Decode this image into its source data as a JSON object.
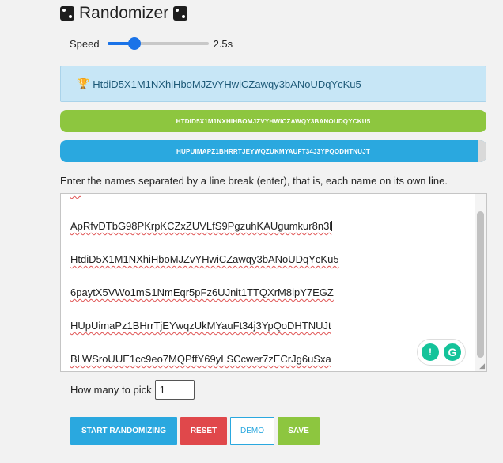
{
  "header": {
    "title": "Randomizer",
    "left_icon": "dice-icon",
    "right_icon": "dice-icon"
  },
  "speed": {
    "label": "Speed",
    "value_label": "2.5s",
    "slider_fraction": 0.27
  },
  "winner": {
    "icon": "trophy-icon",
    "text": "HtdiD5X1M1NXhiHboMJZvYHwiCZawqy3bANoUDqYcKu5"
  },
  "history": [
    "HTDID5X1M1NXHIHBOMJZVYHWICZAWQY3BANOUDQYCKU5",
    "HUPUIMAPZ1BHRRTJEYWQZUKMYAUFT34J3YPQODHTNUJT"
  ],
  "instructions": "Enter the names separated by a line break (enter), that is, each name on its own line.",
  "names_textarea": {
    "lines": [
      "ApRfvDTbG98PKrpKCZxZUVLfS9PgzuhKAUgumkur8n3l",
      "HtdiD5X1M1NXhiHboMJZvYHwiCZawqy3bANoUDqYcKu5",
      "6paytX5VWo1mS1NmEqr5pFz6UJnit1TTQXrM8ipY7EGZ",
      "HUpUimaPz1BHrrTjEYwqzUkMYauFt34j3YpQoDHTNUJt",
      "BLWSroUUE1cc9eo7MQPffY69yLSCcwer7zECrJg6uSxa"
    ]
  },
  "pick": {
    "label": "How many to pick",
    "value": "1"
  },
  "buttons": {
    "start": "START RANDOMIZING",
    "reset": "RESET",
    "demo": "DEMO",
    "save": "SAVE"
  },
  "colors": {
    "accent_blue": "#2aa8df",
    "accent_green": "#8dc63f",
    "danger_red": "#e0484b",
    "winner_bg": "#c7e6f6"
  }
}
